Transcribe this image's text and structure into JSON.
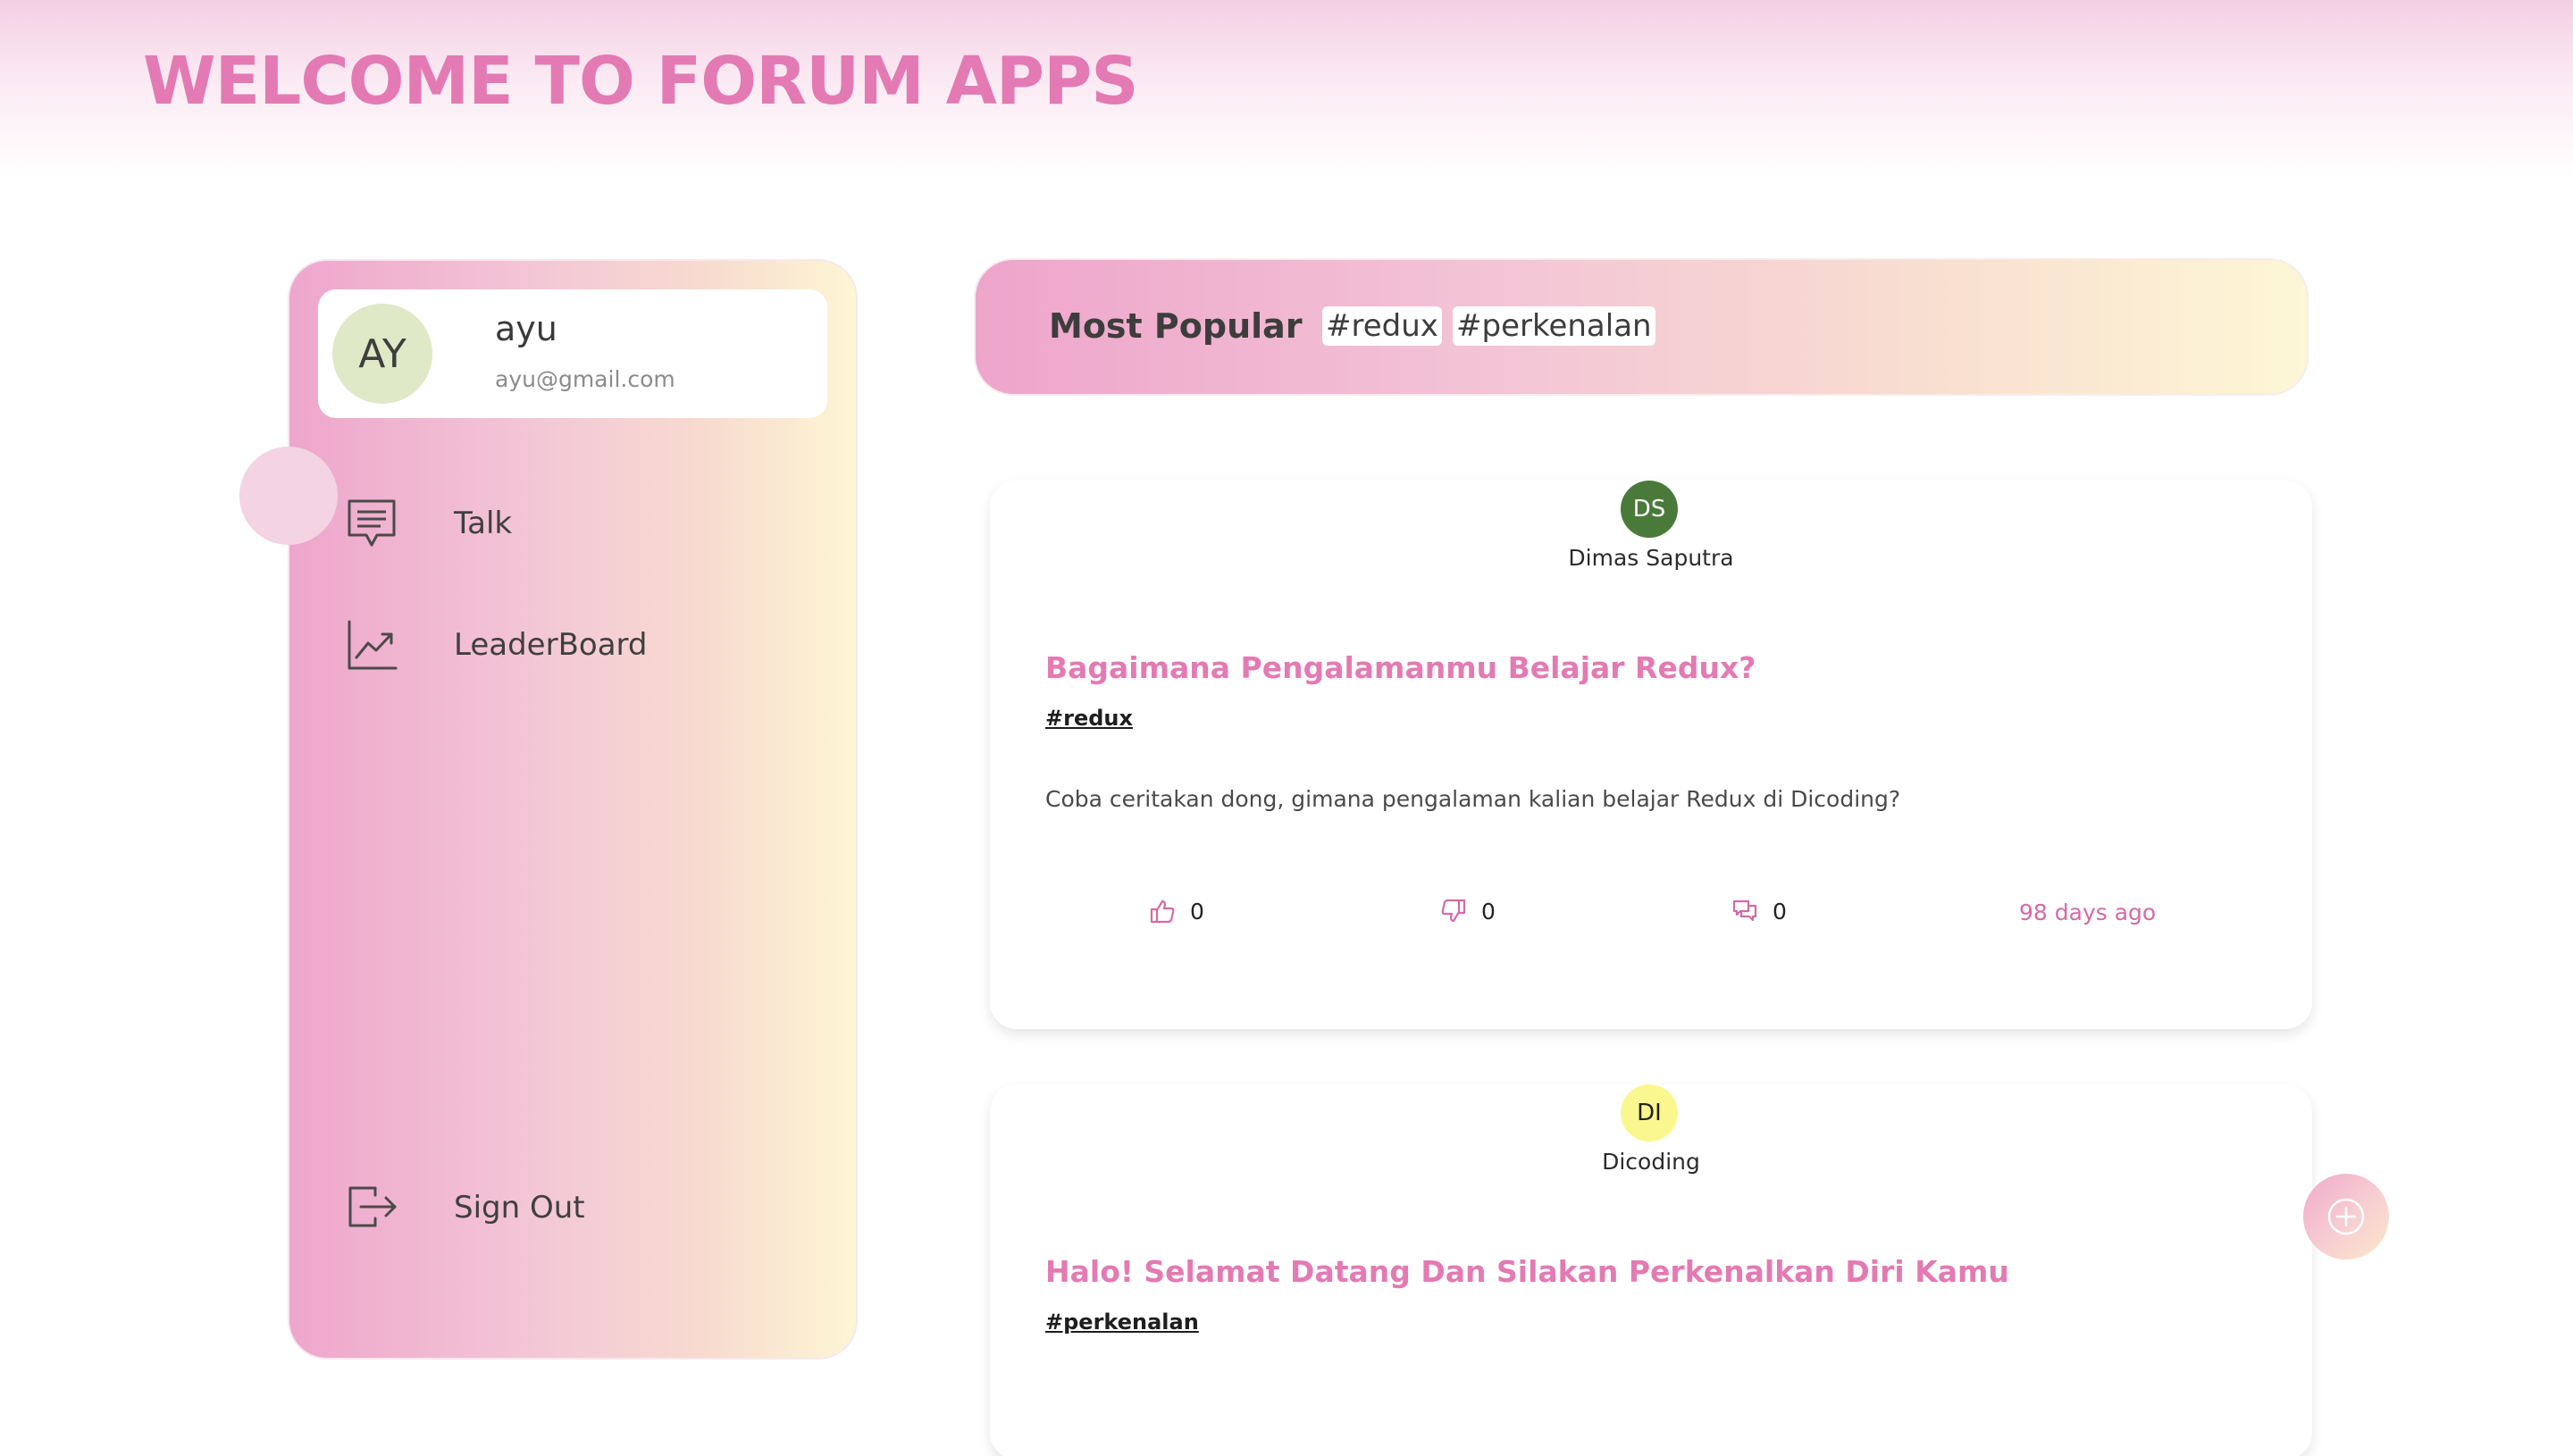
{
  "header": {
    "title": "WELCOME TO FORUM APPS"
  },
  "user": {
    "initials": "AY",
    "name": "ayu",
    "email": "ayu@gmail.com"
  },
  "nav": {
    "items": [
      {
        "label": "Talk",
        "icon": "chat-icon",
        "active": true
      },
      {
        "label": "LeaderBoard",
        "icon": "chart-trend-icon",
        "active": false
      }
    ],
    "sign_out": {
      "label": "Sign Out",
      "icon": "sign-out-icon"
    }
  },
  "popular": {
    "label": "Most Popular",
    "tags": [
      "#redux",
      "#perkenalan"
    ]
  },
  "threads": [
    {
      "owner_initials": "DS",
      "owner_name": "Dimas Saputra",
      "owner_color": "#4a7a3a",
      "title": "Bagaimana Pengalamanmu Belajar Redux?",
      "tag": "#redux",
      "body": "Coba ceritakan dong, gimana pengalaman kalian belajar Redux di Dicoding?",
      "likes": "0",
      "dislikes": "0",
      "comments": "0",
      "time": "98 days ago"
    },
    {
      "owner_initials": "DI",
      "owner_name": "Dicoding",
      "owner_color": "#fbf78f",
      "title": "Halo! Selamat Datang Dan Silakan Perkenalkan Diri Kamu",
      "tag": "#perkenalan"
    }
  ],
  "colors": {
    "accent": "#e47ab3",
    "gradient_start": "#eea6cc",
    "gradient_end": "#fdf6d4"
  },
  "fab": {
    "icon": "plus-icon"
  }
}
